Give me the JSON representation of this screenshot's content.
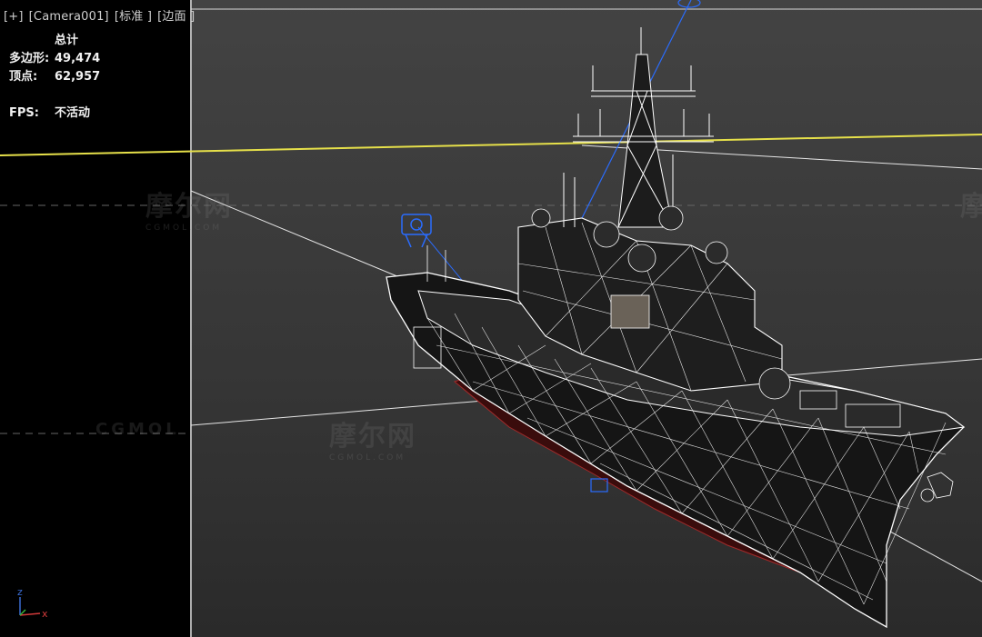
{
  "viewport": {
    "menu_plus": "[+]",
    "camera": "[Camera001]",
    "shading": "[标准 ]",
    "edges": "[边面 ]"
  },
  "stats": {
    "title": "总计",
    "polygons_label": "多边形:",
    "polygons_value": "49,474",
    "vertices_label": "顶点:",
    "vertices_value": "62,957",
    "fps_label": "FPS:",
    "fps_value": "不活动"
  },
  "watermarks": {
    "brand": "摩尔网",
    "site": "CGMOL.COM",
    "brand_latin": "CGMOL"
  },
  "axis": {
    "x": "x",
    "z": "z"
  },
  "colors": {
    "wireframe": "#ffffff",
    "horizon": "#e6e04a",
    "camera_target": "#2a6cff",
    "hull_underside": "#5a1212"
  },
  "icons": [
    "camera-icon",
    "axis-gizmo-icon"
  ]
}
